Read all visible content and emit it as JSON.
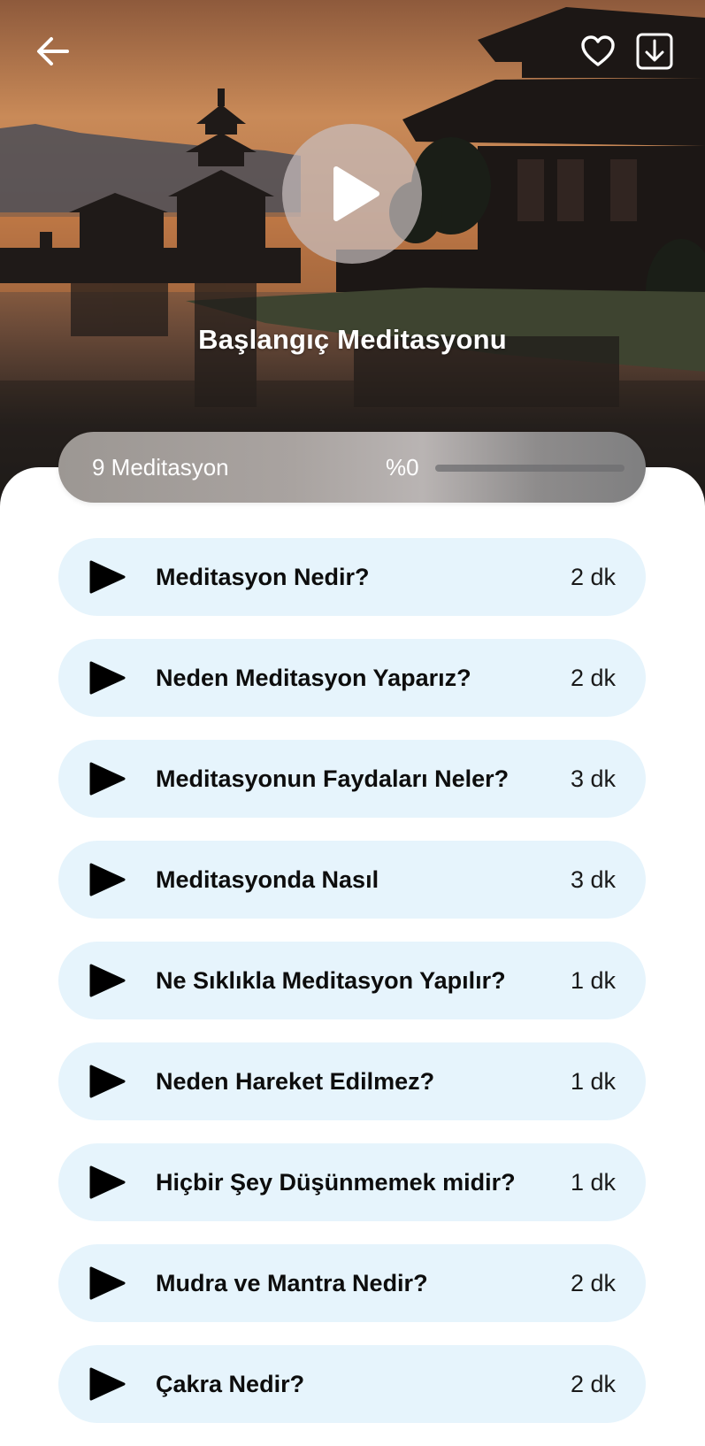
{
  "header": {
    "back_icon": "arrow-left-icon",
    "favorite_icon": "heart-outline-icon",
    "download_icon": "download-box-icon",
    "play_icon": "play-icon",
    "title": "Başlangıç Meditasyonu"
  },
  "progress": {
    "count_label": "9 Meditasyon",
    "percent_label": "%0",
    "value": 0
  },
  "meditations": [
    {
      "title": "Meditasyon Nedir?",
      "duration": "2 dk"
    },
    {
      "title": "Neden Meditasyon Yaparız?",
      "duration": "2 dk"
    },
    {
      "title": "Meditasyonun Faydaları Neler?",
      "duration": "3 dk"
    },
    {
      "title": "Meditasyonda Nasıl",
      "duration": "3 dk"
    },
    {
      "title": "Ne Sıklıkla Meditasyon Yapılır?",
      "duration": "1 dk"
    },
    {
      "title": "Neden Hareket Edilmez?",
      "duration": "1 dk"
    },
    {
      "title": "Hiçbir Şey Düşünmemek midir?",
      "duration": "1 dk"
    },
    {
      "title": "Mudra ve Mantra Nedir?",
      "duration": "2 dk"
    },
    {
      "title": "Çakra Nedir?",
      "duration": "2 dk"
    }
  ],
  "colors": {
    "item_background": "#e6f4fc",
    "text": "#0d0d0d",
    "hero_sky": "#c98a58"
  }
}
